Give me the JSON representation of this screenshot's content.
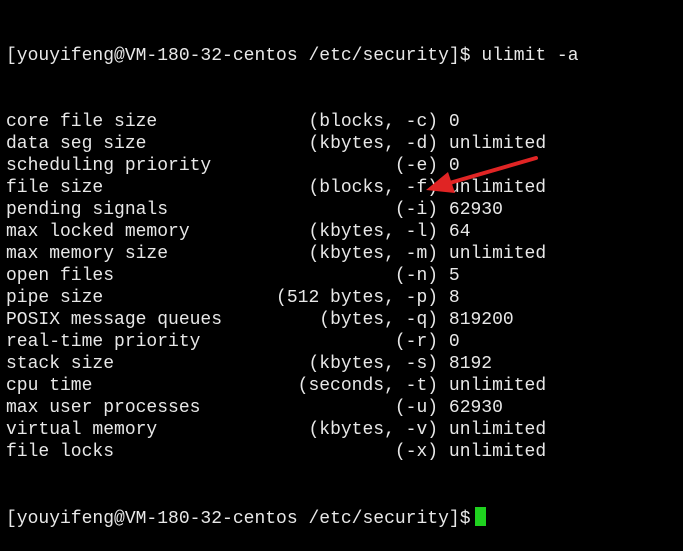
{
  "terminal": {
    "prompt_user_host": "[youyifeng@VM-180-32-centos",
    "prompt_path": "/etc/security]$",
    "command": "ulimit -a",
    "rows": [
      {
        "name": "core file size",
        "unit": "(blocks, -c)",
        "value": "0"
      },
      {
        "name": "data seg size",
        "unit": "(kbytes, -d)",
        "value": "unlimited"
      },
      {
        "name": "scheduling priority",
        "unit": "(-e)",
        "value": "0"
      },
      {
        "name": "file size",
        "unit": "(blocks, -f)",
        "value": "unlimited"
      },
      {
        "name": "pending signals",
        "unit": "(-i)",
        "value": "62930"
      },
      {
        "name": "max locked memory",
        "unit": "(kbytes, -l)",
        "value": "64"
      },
      {
        "name": "max memory size",
        "unit": "(kbytes, -m)",
        "value": "unlimited"
      },
      {
        "name": "open files",
        "unit": "(-n)",
        "value": "5"
      },
      {
        "name": "pipe size",
        "unit": "(512 bytes, -p)",
        "value": "8"
      },
      {
        "name": "POSIX message queues",
        "unit": "(bytes, -q)",
        "value": "819200"
      },
      {
        "name": "real-time priority",
        "unit": "(-r)",
        "value": "0"
      },
      {
        "name": "stack size",
        "unit": "(kbytes, -s)",
        "value": "8192"
      },
      {
        "name": "cpu time",
        "unit": "(seconds, -t)",
        "value": "unlimited"
      },
      {
        "name": "max user processes",
        "unit": "(-u)",
        "value": "62930"
      },
      {
        "name": "virtual memory",
        "unit": "(kbytes, -v)",
        "value": "unlimited"
      },
      {
        "name": "file locks",
        "unit": "(-x)",
        "value": "unlimited"
      }
    ],
    "final_prompt_user_host": "[youyifeng@VM-180-32-centos",
    "final_prompt_path": "/etc/security]$"
  },
  "colors": {
    "background": "#000000",
    "text": "#e8e8e8",
    "cursor": "#1fd11f",
    "annotation_arrow": "#e02424"
  },
  "icons": {
    "annotation": "red-arrow-icon",
    "cursor": "block-cursor-icon"
  }
}
